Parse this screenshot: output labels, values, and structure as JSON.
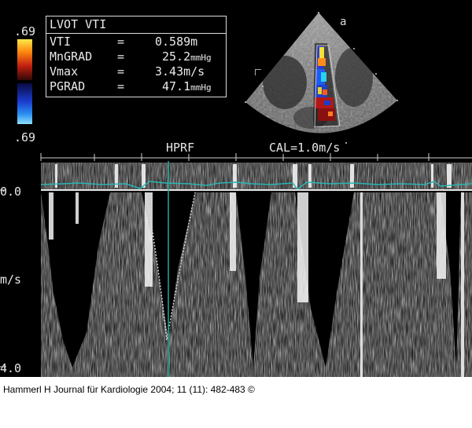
{
  "measurement": {
    "title": "LVOT VTI",
    "rows": [
      {
        "label": "VTI",
        "eq": "=",
        "value": "0.589m",
        "unit": ""
      },
      {
        "label": "MnGRAD",
        "eq": "=",
        "value": "25.2",
        "unit": "mmHg"
      },
      {
        "label": "Vmax",
        "eq": "=",
        "value": "3.43m/s",
        "unit": ""
      },
      {
        "label": "PGRAD",
        "eq": "=",
        "value": "47.1",
        "unit": "mmHg"
      }
    ]
  },
  "color_scale": {
    "top_label": ".69",
    "bottom_label": ".69"
  },
  "doppler": {
    "mode_label": "HPRF",
    "calibration_label": "CAL=1.0m/s",
    "baseline_label": "0.0",
    "axis_unit_label": "m/s",
    "max_label": "4.0"
  },
  "sector_marker": "a",
  "caption": "Hammerl H Journal für Kardiologie 2004; 11 (11): 482-483 ©"
}
